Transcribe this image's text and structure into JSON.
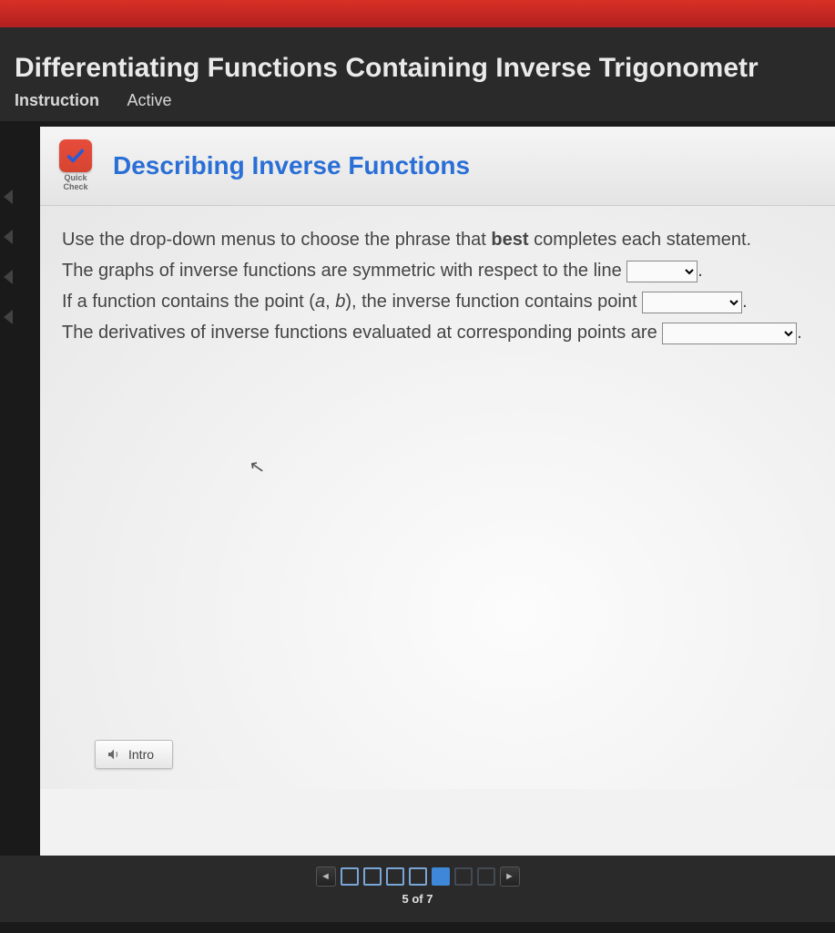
{
  "header": {
    "page_title": "Differentiating Functions Containing Inverse Trigonometr",
    "tab_instruction": "Instruction",
    "tab_active": "Active"
  },
  "quick_check": {
    "line1": "Quick",
    "line2": "Check"
  },
  "content": {
    "title": "Describing Inverse Functions",
    "intro_line_a": "Use the drop-down menus to choose the phrase that ",
    "intro_bold": "best",
    "intro_line_b": " completes each statement.",
    "stmt1": "The graphs of inverse functions are symmetric with respect to the line ",
    "stmt2_a": "If a function contains the point (",
    "stmt2_var_a": "a",
    "stmt2_mid": ", ",
    "stmt2_var_b": "b",
    "stmt2_b": "), the inverse function contains point ",
    "stmt3": "The derivatives of inverse functions evaluated at corresponding points are ",
    "period": "."
  },
  "buttons": {
    "intro": "Intro"
  },
  "footer": {
    "page_indicator": "5 of 7"
  }
}
